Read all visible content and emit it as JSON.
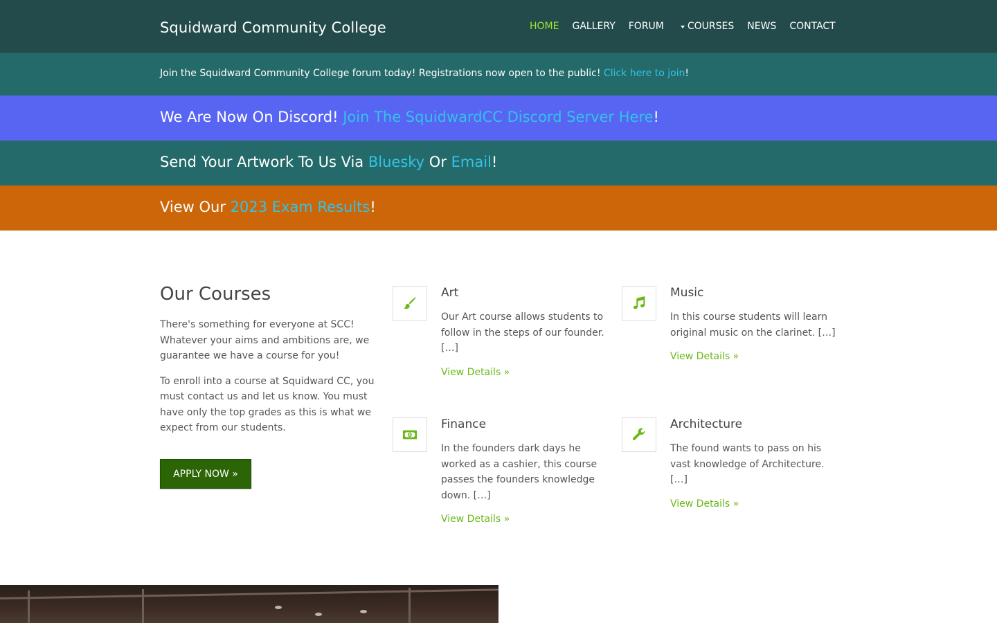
{
  "header": {
    "site_title": "Squidward Community College",
    "nav": [
      {
        "label": "HOME",
        "active": true
      },
      {
        "label": "GALLERY",
        "active": false
      },
      {
        "label": "FORUM",
        "active": false
      },
      {
        "label": "COURSES",
        "active": false,
        "dropdown": true
      },
      {
        "label": "NEWS",
        "active": false
      },
      {
        "label": "CONTACT",
        "active": false
      }
    ]
  },
  "banners": {
    "forum": {
      "text": "Join the Squidward Community College forum today! Registrations now open to the public! ",
      "link": "Click here to join",
      "suffix": "!"
    },
    "discord": {
      "text": "We Are Now On Discord! ",
      "link": "Join The SquidwardCC Discord Server Here",
      "suffix": "!"
    },
    "artwork": {
      "text": "Send Your Artwork To Us Via ",
      "link1": "Bluesky",
      "middle": " Or ",
      "link2": "Email",
      "suffix": "!"
    },
    "exam": {
      "text": "View Our ",
      "link": "2023 Exam Results",
      "suffix": "!"
    }
  },
  "courses_section": {
    "heading": "Our Courses",
    "paragraph1": "There's something for everyone at SCC! Whatever your aims and ambitions are, we guarantee we have a course for you!",
    "paragraph2": "To enroll into a course at Squidward CC, you must contact us and let us know. You must have only the top grades as this is what we expect from our students.",
    "apply_label": "APPLY NOW »",
    "courses": [
      {
        "title": "Art",
        "icon": "paintbrush-icon",
        "desc": "Our Art course allows students to follow in the steps of our founder. […]",
        "link": "View Details »"
      },
      {
        "title": "Music",
        "icon": "music-note-icon",
        "desc": "In this course students will learn original music on the clarinet. […]",
        "link": "View Details »"
      },
      {
        "title": "Finance",
        "icon": "money-icon",
        "desc": "In the founders dark days he worked as a cashier, this course passes the founders knowledge down. […]",
        "link": "View Details »"
      },
      {
        "title": "Architecture",
        "icon": "wrench-icon",
        "desc": "The found wants to pass on his vast knowledge of Architecture. […]",
        "link": "View Details »"
      }
    ]
  },
  "colors": {
    "header_bg": "#234b4b",
    "band_teal": "#256a6a",
    "band_discord": "#5865f2",
    "band_orange": "#cc6608",
    "link_blue": "#33c3e8",
    "accent_green": "#69b816",
    "nav_active": "#9ae82f",
    "button_green": "#2b6506"
  }
}
